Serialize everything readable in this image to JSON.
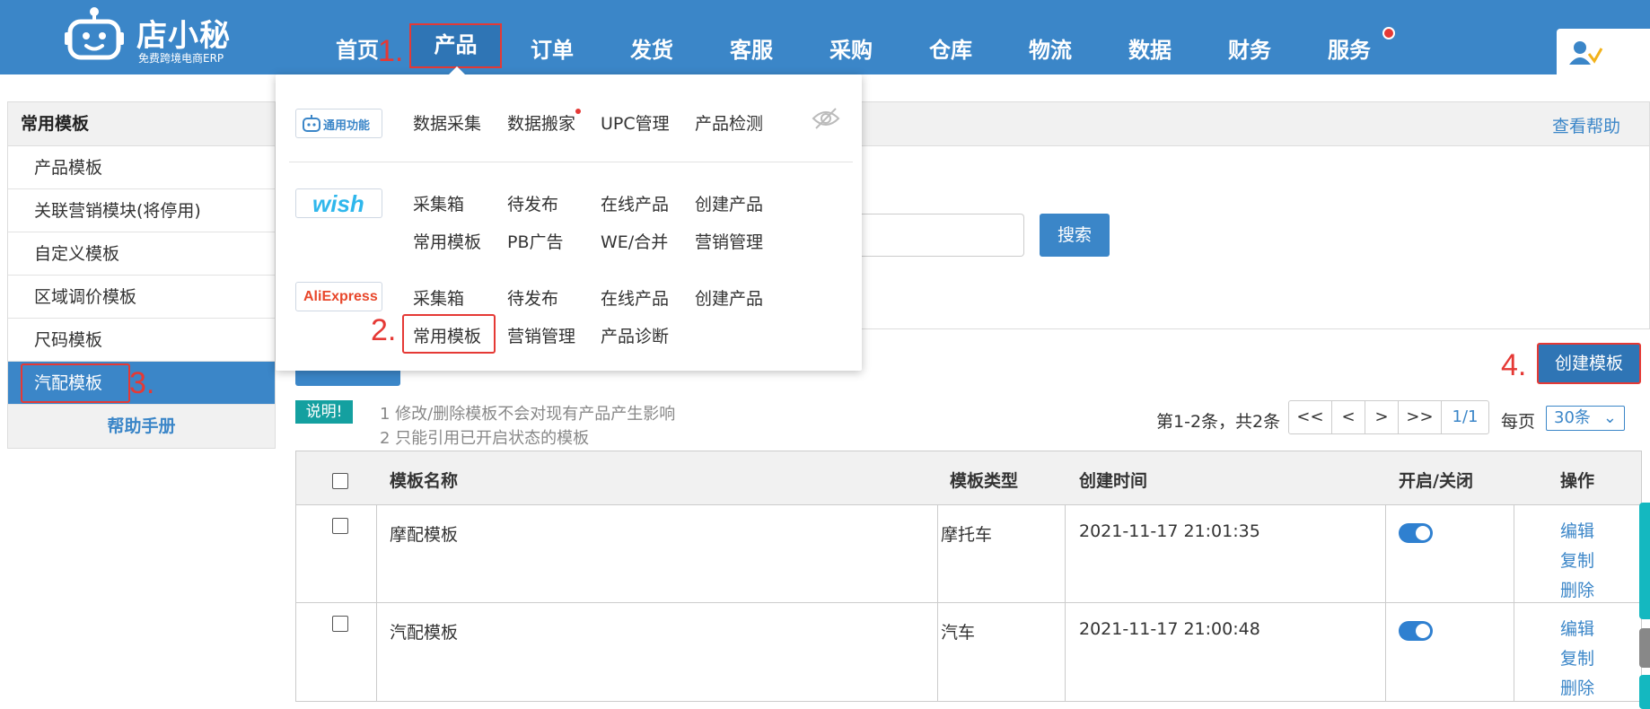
{
  "header": {
    "logo_title": "店小秘",
    "logo_subtitle": "免费跨境电商ERP",
    "nav": [
      "首页",
      "产品",
      "订单",
      "发货",
      "客服",
      "采购",
      "仓库",
      "物流",
      "数据",
      "财务",
      "服务"
    ],
    "active_nav": "产品"
  },
  "steps": {
    "s1": "1.",
    "s2": "2.",
    "s3": "3.",
    "s4": "4."
  },
  "dropdown": {
    "general": {
      "badge": "通用功能",
      "links": [
        "数据采集",
        "数据搬家",
        "UPC管理",
        "产品检测"
      ]
    },
    "wish": {
      "badge": "wish",
      "row1": [
        "采集箱",
        "待发布",
        "在线产品",
        "创建产品"
      ],
      "row2": [
        "常用模板",
        "PB广告",
        "WE/合并",
        "营销管理"
      ]
    },
    "aliexpress": {
      "badge": "AliExpress",
      "row1": [
        "采集箱",
        "待发布",
        "在线产品",
        "创建产品"
      ],
      "row2": [
        "常用模板",
        "营销管理",
        "产品诊断"
      ]
    }
  },
  "sidebar": {
    "header": "常用模板",
    "items": [
      "产品模板",
      "关联营销模块(将停用)",
      "自定义模板",
      "区域调价模板",
      "尺码模板",
      "汽配模板"
    ],
    "help": "帮助手册"
  },
  "panel": {
    "help_link": "查看帮助",
    "search_button": "搜索"
  },
  "toolbar": {
    "create_button": "创建模板"
  },
  "notes": {
    "tag": "说明!",
    "line1": "1 修改/删除模板不会对现有产品产生影响",
    "line2": "2 只能引用已开启状态的模板"
  },
  "pager": {
    "info": "第1-2条，共2条",
    "first": "<<",
    "prev": "<",
    "next": ">",
    "last": ">>",
    "page": "1/1",
    "per_label": "每页",
    "per_value": "30条"
  },
  "table": {
    "headers": {
      "name": "模板名称",
      "type": "模板类型",
      "created": "创建时间",
      "toggle": "开启/关闭",
      "ops": "操作"
    },
    "rows": [
      {
        "name": "摩配模板",
        "type": "摩托车",
        "created": "2021-11-17 21:01:35",
        "enabled": true,
        "ops": [
          "编辑",
          "复制",
          "删除"
        ]
      },
      {
        "name": "汽配模板",
        "type": "汽车",
        "created": "2021-11-17 21:00:48",
        "enabled": true,
        "ops": [
          "编辑",
          "复制",
          "删除"
        ]
      }
    ]
  },
  "colors": {
    "brand": "#3b86c8",
    "highlight": "#e53935",
    "note": "#14a0a0"
  }
}
